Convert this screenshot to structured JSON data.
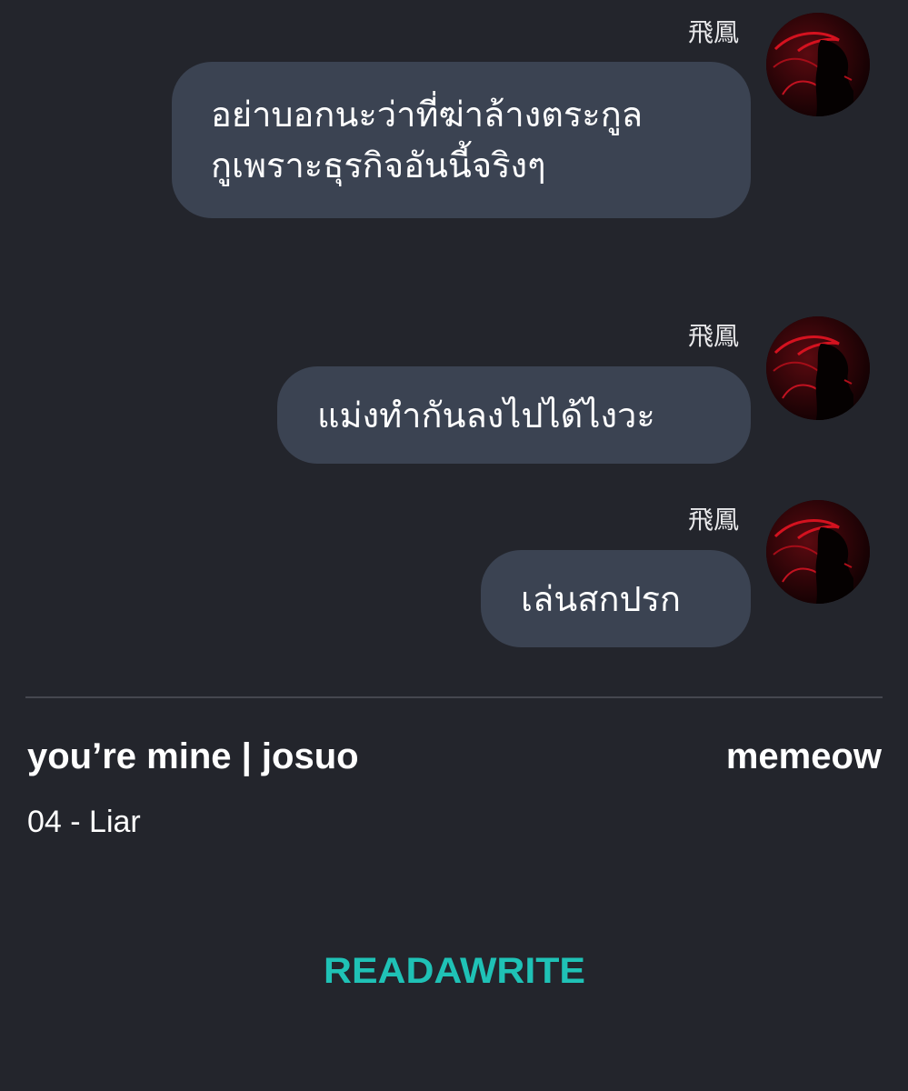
{
  "messages": [
    {
      "sender": "飛鳳",
      "lines": [
        "อย่าบอกนะว่าที่ฆ่าล้างตระกูล",
        "กูเพราะธุรกิจอันนี้จริงๆ"
      ]
    },
    {
      "sender": "飛鳳",
      "lines": [
        "แม่งทำกันลงไปได้ไงวะ"
      ]
    },
    {
      "sender": "飛鳳",
      "lines": [
        "เล่นสกปรก"
      ]
    }
  ],
  "story": {
    "title": "you’re mine | josuo",
    "author": "memeow",
    "chapter": "04 - Liar"
  },
  "brand": {
    "logo_text": "READAWRITE",
    "logo_color": "#1fc2b6"
  },
  "colors": {
    "background": "#23252c",
    "bubble": "#3b4352",
    "divider": "#45474f"
  },
  "icons": {
    "avatar": "avatar-red-silhouette-icon"
  }
}
